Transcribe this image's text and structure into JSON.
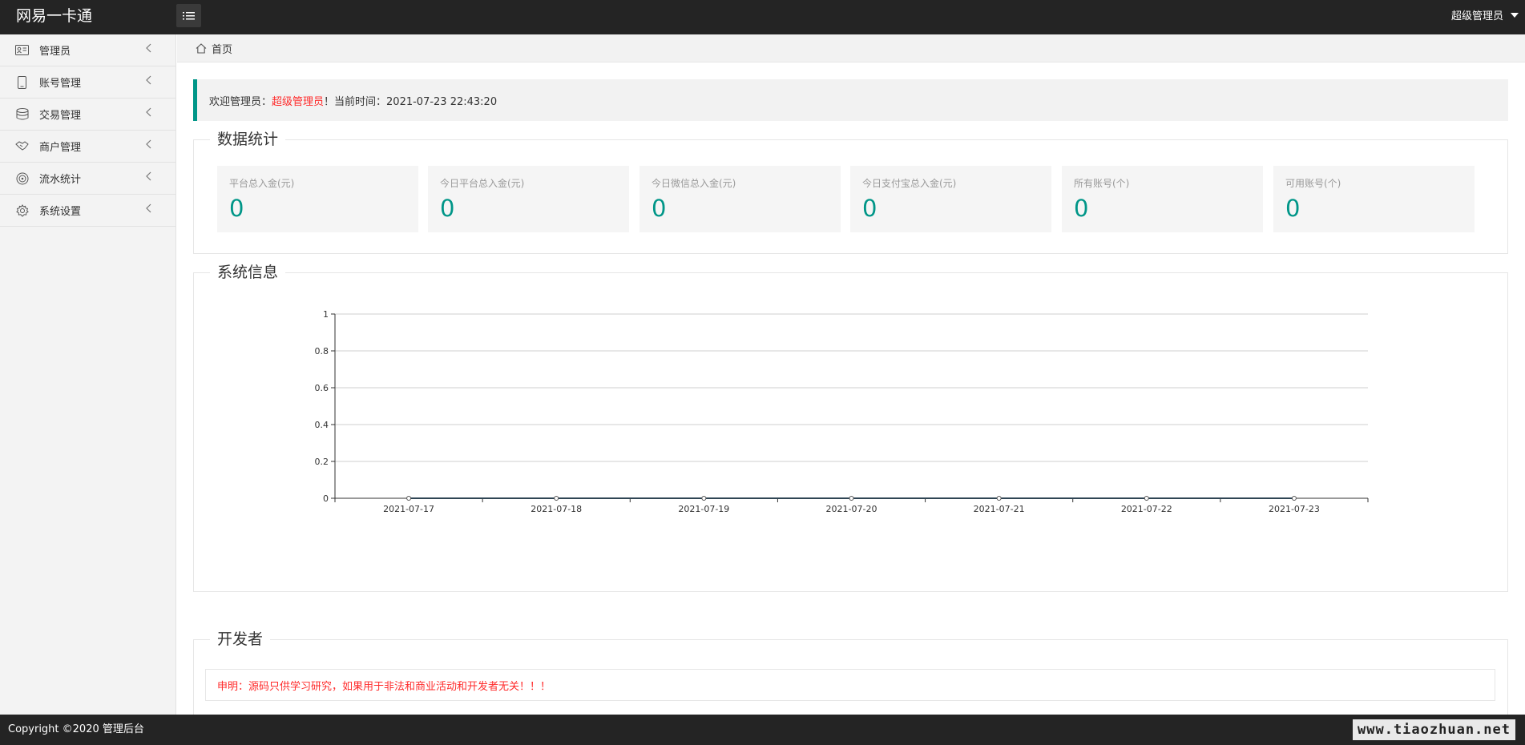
{
  "header": {
    "app_title": "网易一卡通",
    "user_name": "超级管理员"
  },
  "sidebar": {
    "items": [
      {
        "label": "管理员",
        "icon": "id-card-icon"
      },
      {
        "label": "账号管理",
        "icon": "phone-icon"
      },
      {
        "label": "交易管理",
        "icon": "database-icon"
      },
      {
        "label": "商户管理",
        "icon": "handshake-icon"
      },
      {
        "label": "流水统计",
        "icon": "target-icon"
      },
      {
        "label": "系统设置",
        "icon": "gear-icon"
      }
    ]
  },
  "breadcrumb": {
    "home": "首页"
  },
  "welcome": {
    "prefix": "欢迎管理员：",
    "user": "超级管理员",
    "suffix": "！当前时间：2021-07-23 22:43:20"
  },
  "stats": {
    "legend": "数据统计",
    "cards": [
      {
        "label": "平台总入金(元)",
        "value": "0"
      },
      {
        "label": "今日平台总入金(元)",
        "value": "0"
      },
      {
        "label": "今日微信总入金(元)",
        "value": "0"
      },
      {
        "label": "今日支付宝总入金(元)",
        "value": "0"
      },
      {
        "label": "所有账号(个)",
        "value": "0"
      },
      {
        "label": "可用账号(个)",
        "value": "0"
      }
    ]
  },
  "system_info": {
    "legend": "系统信息"
  },
  "developer": {
    "legend": "开发者",
    "notice": "申明：源码只供学习研究，如果用于非法和商业活动和开发者无关！！！"
  },
  "footer": {
    "copyright": "Copyright ©2020 管理后台",
    "watermark": "www.tiaozhuan.net"
  },
  "colors": {
    "accent": "#009688",
    "header_bg": "#242424",
    "warning_red": "#ff2b2b"
  },
  "chart_data": {
    "type": "line",
    "x": [
      "2021-07-17",
      "2021-07-18",
      "2021-07-19",
      "2021-07-20",
      "2021-07-21",
      "2021-07-22",
      "2021-07-23"
    ],
    "series": [
      {
        "values": [
          0,
          0,
          0,
          0,
          0,
          0,
          0
        ]
      }
    ],
    "ylim": [
      0,
      1
    ],
    "yticks": [
      "0",
      "0.2",
      "0.4",
      "0.6",
      "0.8",
      "1"
    ],
    "grid": true,
    "title": "",
    "xlabel": "",
    "ylabel": ""
  }
}
